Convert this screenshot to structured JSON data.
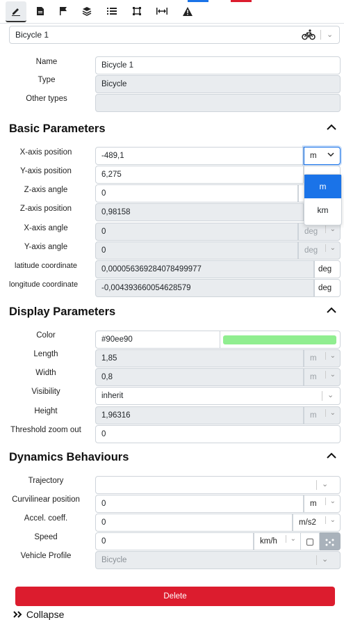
{
  "toolbar": {
    "icons": [
      "pencil-icon",
      "document-icon",
      "flag-icon",
      "layers-icon",
      "list-icon",
      "crop-icon",
      "width-icon",
      "warning-icon"
    ],
    "accent_blue": "#1a73e8",
    "accent_red": "#dc1c2e"
  },
  "object_select": {
    "value": "Bicycle 1",
    "icon": "bicycle-icon"
  },
  "general": {
    "name_label": "Name",
    "name_value": "Bicycle 1",
    "type_label": "Type",
    "type_value": "Bicycle",
    "other_types_label": "Other types",
    "other_types_value": ""
  },
  "basic": {
    "title": "Basic Parameters",
    "x_pos_label": "X-axis position",
    "x_pos_value": "-489,1",
    "x_pos_unit": "m",
    "y_pos_label": "Y-axis position",
    "y_pos_value": "6,275",
    "z_angle_label": "Z-axis angle",
    "z_angle_value": "0",
    "z_pos_label": "Z-axis position",
    "z_pos_value": "0,98158",
    "x_angle_label": "X-axis angle",
    "x_angle_value": "0",
    "x_angle_unit": "deg",
    "y_angle_label": "Y-axis angle",
    "y_angle_value": "0",
    "y_angle_unit": "deg",
    "lat_label": "latitude coordinate",
    "lat_value": "0,000056369284078499977",
    "lat_unit": "deg",
    "lon_label": "longitude coordinate",
    "lon_value": "-0,004393660054628579",
    "lon_unit": "deg",
    "unit_dropdown": {
      "options": [
        "m",
        "km"
      ],
      "selected": "m"
    }
  },
  "display": {
    "title": "Display Parameters",
    "color_label": "Color",
    "color_value": "#90ee90",
    "color_swatch": "#90ee90",
    "length_label": "Length",
    "length_value": "1,85",
    "length_unit": "m",
    "width_label": "Width",
    "width_value": "0,8",
    "width_unit": "m",
    "visibility_label": "Visibility",
    "visibility_value": "inherit",
    "height_label": "Height",
    "height_value": "1,96316",
    "height_unit": "m",
    "threshold_label": "Threshold zoom out",
    "threshold_value": "0"
  },
  "dynamics": {
    "title": "Dynamics Behaviours",
    "trajectory_label": "Trajectory",
    "trajectory_value": "",
    "curv_label": "Curvilinear position",
    "curv_value": "0",
    "curv_unit": "m",
    "accel_label": "Accel. coeff.",
    "accel_value": "0",
    "accel_unit": "m/s2",
    "speed_label": "Speed",
    "speed_value": "0",
    "speed_unit": "km/h",
    "profile_label": "Vehicle Profile",
    "profile_value": "Bicycle"
  },
  "actions": {
    "delete_label": "Delete",
    "collapse_label": "Collapse"
  }
}
